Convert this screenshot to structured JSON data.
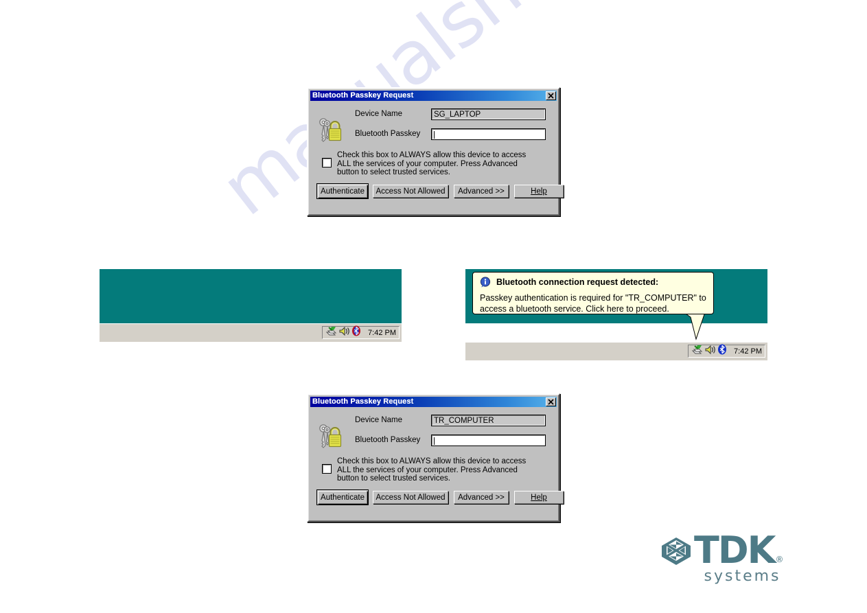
{
  "page": {
    "watermark": "manualshive.com"
  },
  "dialog_top": {
    "title": "Bluetooth Passkey Request",
    "close_label": "✕",
    "icon": "padlock-keys-icon",
    "device_name_label": "Device Name",
    "device_name_value": "SG_LAPTOP",
    "passkey_label": "Bluetooth Passkey",
    "passkey_value": "",
    "checkbox_text": "Check this box to ALWAYS  allow this device to access ALL the services of your computer.   Press Advanced button to select trusted services.",
    "checkbox_checked": "false",
    "buttons": {
      "authenticate": "Authenticate",
      "access_not_allowed": "Access Not Allowed",
      "advanced": "Advanced >>",
      "help": "Help"
    }
  },
  "dialog_bottom": {
    "title": "Bluetooth Passkey Request",
    "close_label": "✕",
    "icon": "padlock-keys-icon",
    "device_name_label": "Device Name",
    "device_name_value": "TR_COMPUTER",
    "passkey_label": "Bluetooth Passkey",
    "passkey_value": "",
    "checkbox_text": "Check this box to ALWAYS  allow this device to access ALL the services of your computer.   Press Advanced button to select trusted services.",
    "checkbox_checked": "false",
    "buttons": {
      "authenticate": "Authenticate",
      "access_not_allowed": "Access Not Allowed",
      "advanced": "Advanced >>",
      "help": "Help"
    }
  },
  "desktop_left": {
    "clock": "7:42 PM",
    "tray_icons": [
      "network-connection-icon",
      "volume-speaker-icon",
      "bluetooth-icon-inactive"
    ],
    "bluetooth_state": "inactive-red"
  },
  "desktop_right": {
    "clock": "7:42 PM",
    "tray_icons": [
      "network-connection-icon",
      "volume-speaker-icon",
      "bluetooth-icon-active"
    ],
    "bluetooth_state": "active-blue"
  },
  "balloon": {
    "icon": "info-icon",
    "heading": "Bluetooth connection request detected:",
    "line1": "Passkey authentication is required for \"TR_COMPUTER\" to",
    "line2": "access a bluetooth service. Click here to proceed."
  },
  "logo": {
    "wordmark": "TDK",
    "registered": "®",
    "subtitle": "systems",
    "emblem": "tdk-diamond-emblem",
    "color": "#4d7a86"
  },
  "colors": {
    "desktop_teal": "#047b7b",
    "taskbar": "#d4d0c8",
    "dialog_face": "#c0c0c0",
    "titlebar_start": "#00009e",
    "titlebar_end": "#58b3ea",
    "balloon_bg": "#ffffe1",
    "watermark": "#9aa0dd"
  }
}
